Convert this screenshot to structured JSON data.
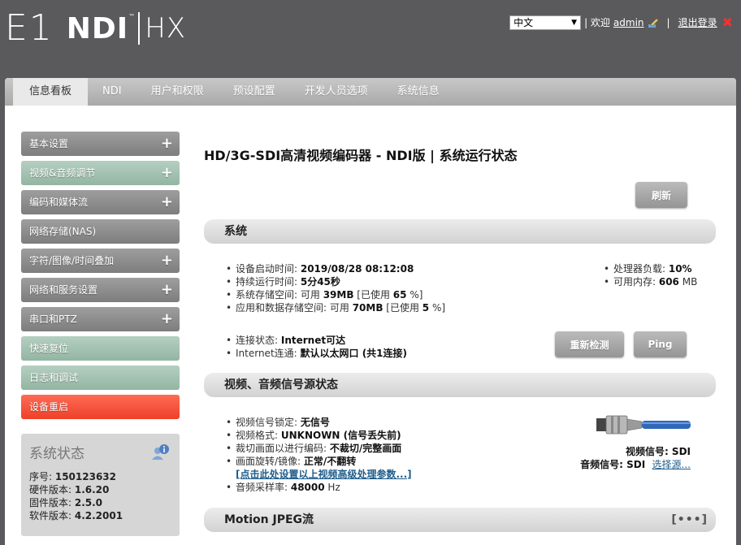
{
  "header": {
    "logo_e1": "E1",
    "logo_ndi": "NDI",
    "logo_tm": "™",
    "logo_hx": "HX",
    "language": "中文",
    "welcome_label": "| 欢迎",
    "user": "admin",
    "divider": "|",
    "logout_label": "退出登录"
  },
  "nav": {
    "tabs": [
      {
        "label": "信息看板",
        "active": true
      },
      {
        "label": "NDI"
      },
      {
        "label": "用户和权限"
      },
      {
        "label": "预设配置"
      },
      {
        "label": "开发人员选项"
      },
      {
        "label": "系统信息"
      }
    ]
  },
  "sidebar": {
    "items": [
      {
        "label": "基本设置",
        "style": "gray",
        "expand": "+"
      },
      {
        "label": "视频&音频调节",
        "style": "green",
        "expand": "+"
      },
      {
        "label": "编码和媒体流",
        "style": "gray",
        "expand": "+"
      },
      {
        "label": "网络存储(NAS)",
        "style": "gray"
      },
      {
        "label": "字符/图像/时间叠加",
        "style": "gray",
        "expand": "+"
      },
      {
        "label": "网络和服务设置",
        "style": "gray",
        "expand": "+"
      },
      {
        "label": "串口和PTZ",
        "style": "gray",
        "expand": "+"
      },
      {
        "label": "快速复位",
        "style": "green"
      },
      {
        "label": "日志和调试",
        "style": "green"
      },
      {
        "label": "设备重启",
        "style": "red"
      }
    ]
  },
  "status_box": {
    "title": "系统状态",
    "serial_label": "序号: ",
    "serial": "150123632",
    "hw_label": "硬件版本: ",
    "hw": "1.6.20",
    "fw_label": "固件版本: ",
    "fw": "2.5.0",
    "sw_label": "软件版本: ",
    "sw": "4.2.2001"
  },
  "main": {
    "title": "HD/3G-SDI高清视频编码器 - NDI版 | 系统运行状态",
    "refresh_button": "刷新",
    "system_section": "系统",
    "boot_time_label": "设备启动时间: ",
    "boot_time": "2019/08/28 08:12:08",
    "uptime_label": "持续运行时间: ",
    "uptime": "5分45秒",
    "sys_storage_label": "系统存储空间: 可用 ",
    "sys_storage_free": "39MB",
    "sys_storage_used_pre": " [已使用 ",
    "sys_storage_used": "65",
    "sys_storage_used_post": " %]",
    "app_storage_label": "应用和数据存储空间: 可用 ",
    "app_storage_free": "70MB",
    "app_storage_used_pre": " [已使用 ",
    "app_storage_used": "5",
    "app_storage_used_post": " %]",
    "cpu_label": "处理器负载: ",
    "cpu": "10%",
    "mem_label": "可用内存: ",
    "mem": "606",
    "mem_unit": " MB",
    "conn_label": "连接状态: ",
    "conn": "Internet可达",
    "inet_label": "Internet连通: ",
    "inet": "默认以太网口 (共1连接)",
    "recheck_button": "重新检测",
    "ping_button": "Ping",
    "av_section": "视频、音频信号源状态",
    "video_lock_label": "视频信号锁定: ",
    "video_lock": "无信号",
    "video_format_label": "视频格式: ",
    "video_format": "UNKNOWN (信号丢失前)",
    "crop_label": "裁切画面以进行编码: ",
    "crop": "不裁切/完整画面",
    "rotate_label": "画面旋转/镜像: ",
    "rotate": "正常/不翻转",
    "advanced_link": "[点击此处设置以上视频高级处理参数...]",
    "audio_rate_label": "音频采样率: ",
    "audio_rate": "48000",
    "audio_rate_unit": " Hz",
    "video_signal_label": "视频信号: ",
    "video_signal": "SDI",
    "audio_signal_label": "音频信号: ",
    "audio_signal": "SDI",
    "select_source_link": "选择源...",
    "mjpeg_section": "Motion JPEG流",
    "mjpeg_more": "[•••]"
  }
}
